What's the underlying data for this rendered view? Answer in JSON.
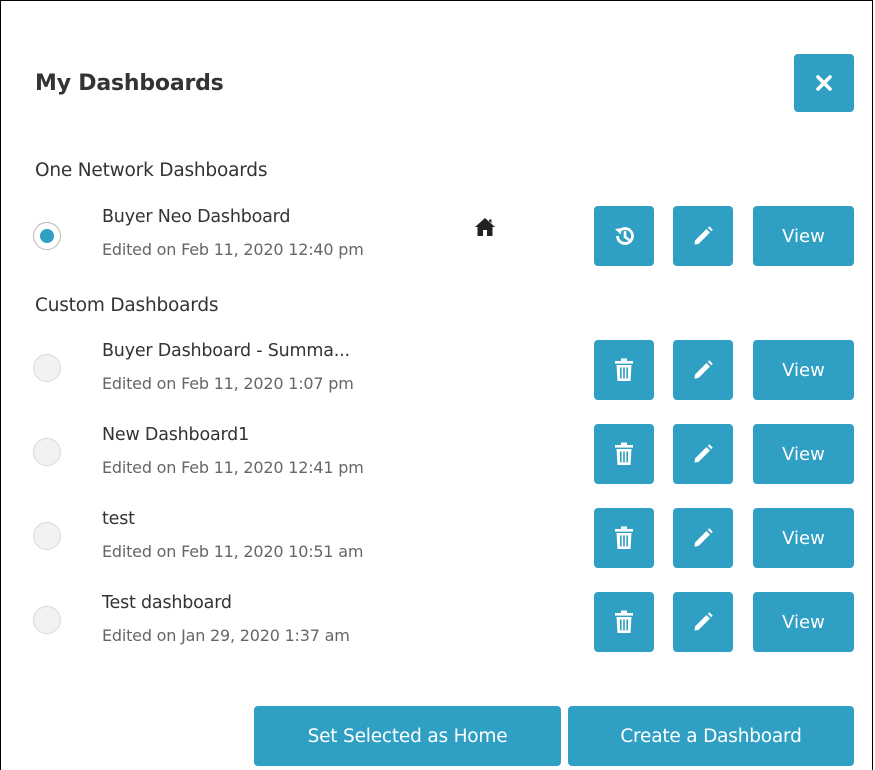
{
  "dialog": {
    "title": "My Dashboards",
    "close_icon": "close-icon"
  },
  "sections": {
    "network": "One Network Dashboards",
    "custom": "Custom Dashboards"
  },
  "network_dashboards": [
    {
      "name": "Buyer Neo Dashboard",
      "edited": "Edited on Feb 11, 2020 12:40 pm",
      "selected": true,
      "is_home": true,
      "view_label": "View"
    }
  ],
  "custom_dashboards": [
    {
      "name": "Buyer Dashboard - Summa...",
      "edited": "Edited on Feb 11, 2020 1:07 pm",
      "selected": false,
      "view_label": "View"
    },
    {
      "name": "New Dashboard1",
      "edited": "Edited on Feb 11, 2020 12:41 pm",
      "selected": false,
      "view_label": "View"
    },
    {
      "name": "test",
      "edited": "Edited on Feb 11, 2020 10:51 am",
      "selected": false,
      "view_label": "View"
    },
    {
      "name": "Test dashboard",
      "edited": "Edited on Jan 29, 2020 1:37 am",
      "selected": false,
      "view_label": "View"
    }
  ],
  "footer": {
    "set_home_label": "Set Selected as Home",
    "create_label": "Create a Dashboard"
  },
  "colors": {
    "accent": "#2f9fc3",
    "text": "#333333",
    "muted": "#666666"
  },
  "icons": [
    "close-icon",
    "home-icon",
    "restore-history-icon",
    "pencil-icon",
    "trash-icon"
  ]
}
